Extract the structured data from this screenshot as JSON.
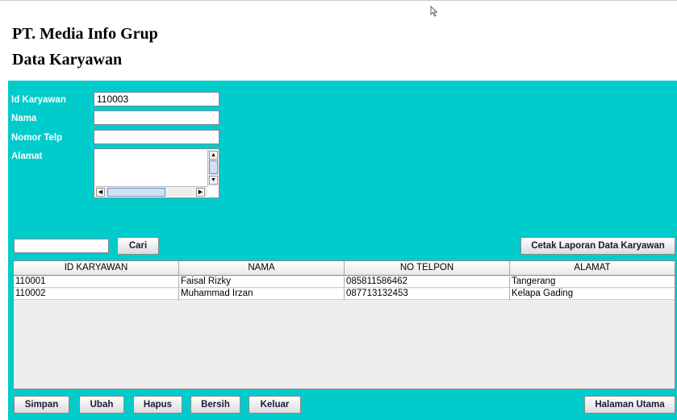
{
  "header": {
    "company": "PT. Media Info Grup",
    "subtitle": "Data Karyawan"
  },
  "form": {
    "id_label": "Id Karyawan",
    "id_value": "110003",
    "nama_label": "Nama",
    "nama_value": "",
    "telp_label": "Nomor Telp",
    "telp_value": "",
    "alamat_label": "Alamat",
    "alamat_value": ""
  },
  "search": {
    "value": "",
    "button": "Cari"
  },
  "report_button": "Cetak Laporan Data Karyawan",
  "table": {
    "columns": [
      "ID KARYAWAN",
      "NAMA",
      "NO TELPON",
      "ALAMAT"
    ],
    "rows": [
      [
        "110001",
        "Faisal Rizky",
        "085811586462",
        "Tangerang"
      ],
      [
        "110002",
        "Muhammad Irzan",
        "087713132453",
        "Kelapa Gading"
      ]
    ]
  },
  "actions": {
    "simpan": "Simpan",
    "ubah": "Ubah",
    "hapus": "Hapus",
    "bersih": "Bersih",
    "keluar": "Keluar",
    "halaman_utama": "Halaman Utama"
  },
  "colors": {
    "panel": "#00cccc",
    "label_text": "#ffffff"
  },
  "icons": [
    "mouse-cursor-icon",
    "scroll-up-icon",
    "scroll-down-icon",
    "scroll-left-icon",
    "scroll-right-icon"
  ]
}
